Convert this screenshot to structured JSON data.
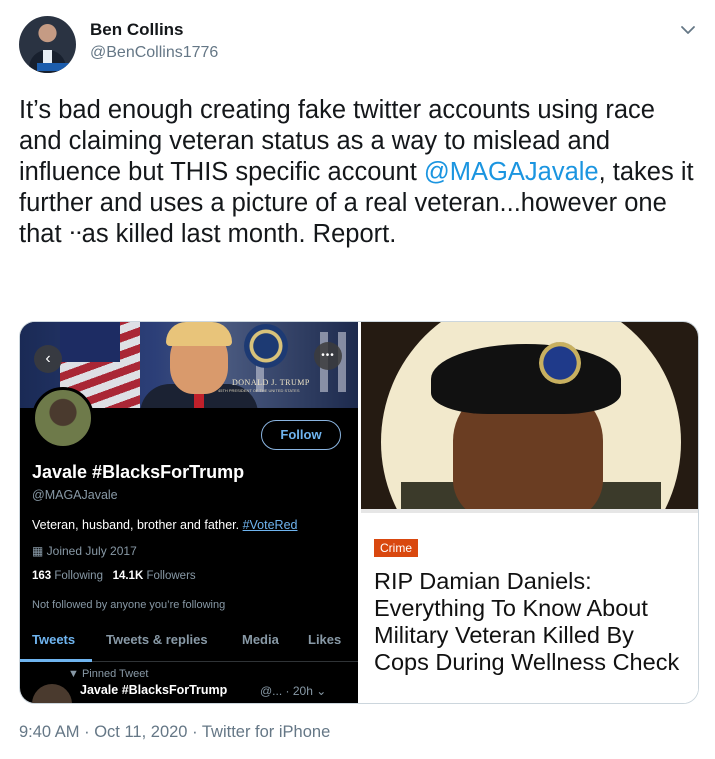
{
  "author": {
    "name": "Ben Collins",
    "handle": "@BenCollins1776"
  },
  "tweet": {
    "text_before_mention": "It’s bad enough creating fake twitter accounts using race and claiming veteran status as a way to mislead and influence but THIS specific account ",
    "mention": "@MAGAJavale",
    "text_after_mention": ", takes it further and uses a picture of a real veteran...however one that ᐧᐧas killed last month. Report."
  },
  "screenshot": {
    "banner_text": "DONALD J. TRUMP",
    "banner_subtext": "45TH PRESIDENT OF THE UNITED STATES",
    "follow_label": "Follow",
    "display_name": "Javale #BlacksForTrump",
    "handle": "@MAGAJavale",
    "bio": "Veteran, husband, brother and father. ",
    "bio_hashtag": "#VoteRed",
    "joined": "Joined July 2017",
    "following_count": "163",
    "following_label": "Following",
    "followers_count": "14.1K",
    "followers_label": "Followers",
    "not_followed": "Not followed by anyone you’re following",
    "tabs": [
      "Tweets",
      "Tweets & replies",
      "Media",
      "Likes"
    ],
    "pinned_label": "Pinned Tweet",
    "pinned_name": "Javale #BlacksForTrump",
    "pinned_meta": "@... · 20h"
  },
  "article": {
    "category": "Crime",
    "headline": "RIP Damian Daniels: Everything To Know About Military Veteran Killed By Cops During Wellness Check"
  },
  "footer": {
    "time": "9:40 AM",
    "date": "Oct 11, 2020",
    "source": "Twitter for iPhone"
  },
  "colors": {
    "link": "#1b95e0",
    "muted": "#657786",
    "badge": "#d9480f"
  }
}
